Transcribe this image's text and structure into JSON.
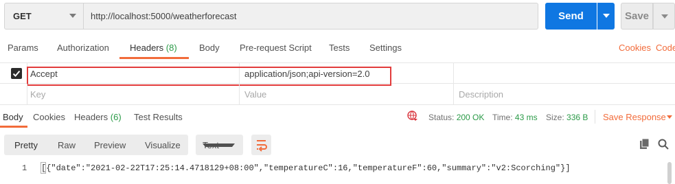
{
  "request": {
    "method": "GET",
    "url": "http://localhost:5000/weatherforecast",
    "send_label": "Send",
    "save_label": "Save"
  },
  "request_tabs": {
    "params": "Params",
    "authorization": "Authorization",
    "headers": "Headers",
    "headers_count": "(8)",
    "body": "Body",
    "prerequest": "Pre-request Script",
    "tests": "Tests",
    "settings": "Settings",
    "cookies_link": "Cookies",
    "code_link": "Code"
  },
  "headers_table": {
    "row": {
      "key": "Accept",
      "value": "application/json;api-version=2.0",
      "checked": true
    },
    "placeholders": {
      "key": "Key",
      "value": "Value",
      "description": "Description"
    }
  },
  "response_tabs": {
    "body": "Body",
    "cookies": "Cookies",
    "headers": "Headers",
    "headers_count": "(6)",
    "test_results": "Test Results"
  },
  "response_status": {
    "status_label": "Status:",
    "status_value": "200 OK",
    "time_label": "Time:",
    "time_value": "43 ms",
    "size_label": "Size:",
    "size_value": "336 B",
    "save_response": "Save Response"
  },
  "format_bar": {
    "pretty": "Pretty",
    "raw": "Raw",
    "preview": "Preview",
    "visualize": "Visualize",
    "type": "Text"
  },
  "response_body": {
    "line_number": "1",
    "content": "[{\"date\":\"2021-02-22T17:25:14.4718129+08:00\",\"temperatureC\":16,\"temperatureF\":60,\"summary\":\"v2:Scorching\"}]"
  },
  "colors": {
    "accent": "#f26b3a",
    "send": "#0f77e2",
    "success": "#2a9a47",
    "highlight": "#e23b3b"
  }
}
